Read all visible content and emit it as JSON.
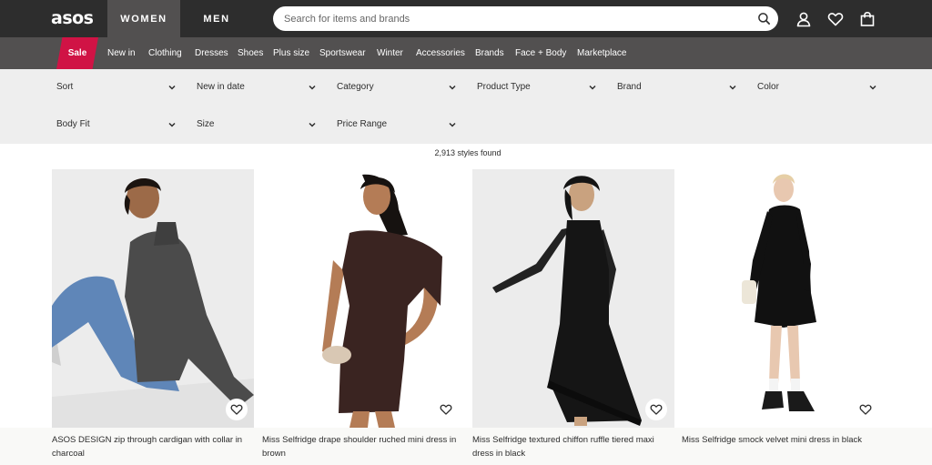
{
  "brand": {
    "logo_text": "asos"
  },
  "gender_tabs": [
    {
      "label": "WOMEN",
      "active": true
    },
    {
      "label": "MEN",
      "active": false
    }
  ],
  "search": {
    "placeholder": "Search for items and brands",
    "value": ""
  },
  "header_icons": [
    "account-icon",
    "heart-icon",
    "bag-icon"
  ],
  "category_nav": {
    "sale_label": "Sale",
    "sale_color": "#d01345",
    "items": [
      "New in",
      "Clothing",
      "Dresses",
      "Shoes",
      "Plus size",
      "Sportswear",
      "Winter",
      "Accessories",
      "Brands",
      "Face + Body",
      "Marketplace"
    ]
  },
  "filters": [
    {
      "label": "Sort"
    },
    {
      "label": "New in date"
    },
    {
      "label": "Category"
    },
    {
      "label": "Product Type"
    },
    {
      "label": "Brand"
    },
    {
      "label": "Color"
    },
    {
      "label": "Body Fit"
    },
    {
      "label": "Size"
    },
    {
      "label": "Price Range"
    }
  ],
  "results_count": "2,913 styles found",
  "products": [
    {
      "title": "ASOS DESIGN zip through cardigan with collar in charcoal"
    },
    {
      "title": "Miss Selfridge drape shoulder ruched mini dress in brown"
    },
    {
      "title": "Miss Selfridge textured chiffon ruffle tiered maxi dress in black"
    },
    {
      "title": "Miss Selfridge smock velvet mini dress in black"
    }
  ],
  "colors": {
    "topbar": "#2d2d2d",
    "nav": "#525050",
    "filters_bg": "#eeeeee",
    "accent_sale": "#d01345"
  }
}
